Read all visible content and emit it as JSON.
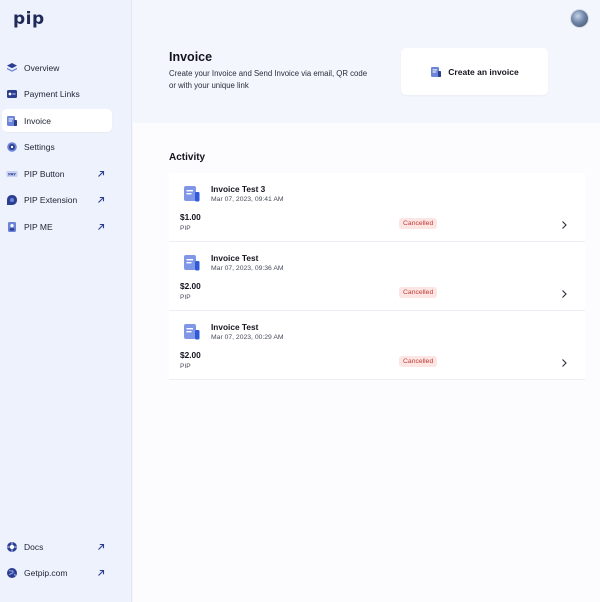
{
  "app": {
    "logo_text": "pip"
  },
  "sidebar": {
    "items": [
      {
        "label": "Overview",
        "icon": "layers-icon",
        "active": false,
        "external": false
      },
      {
        "label": "Payment Links",
        "icon": "link-icon",
        "active": false,
        "external": false
      },
      {
        "label": "Invoice",
        "icon": "invoice-icon",
        "active": true,
        "external": false
      },
      {
        "label": "Settings",
        "icon": "gear-icon",
        "active": false,
        "external": false
      },
      {
        "label": "PIP Button",
        "icon": "pay-button-icon",
        "active": false,
        "external": true
      },
      {
        "label": "PIP Extension",
        "icon": "extension-icon",
        "active": false,
        "external": true
      },
      {
        "label": "PIP ME",
        "icon": "profile-card-icon",
        "active": false,
        "external": true
      }
    ],
    "bottom_items": [
      {
        "label": "Docs",
        "icon": "lifebuoy-icon",
        "external": true
      },
      {
        "label": "Getpip.com",
        "icon": "globe-icon",
        "external": true
      }
    ],
    "pay_badge_text": "PAY"
  },
  "header": {
    "title": "Invoice",
    "description": "Create your Invoice and Send Invoice via email, QR code or with your unique link",
    "create_button_label": "Create an invoice"
  },
  "activity": {
    "title": "Activity",
    "items": [
      {
        "name": "Invoice Test 3",
        "date": "Mar 07, 2023, 09:41 AM",
        "amount": "$1.00",
        "chain": "PIP",
        "status": "Cancelled"
      },
      {
        "name": "Invoice Test",
        "date": "Mar 07, 2023, 09:36 AM",
        "amount": "$2.00",
        "chain": "PIP",
        "status": "Cancelled"
      },
      {
        "name": "Invoice Test",
        "date": "Mar 07, 2023, 00:29 AM",
        "amount": "$2.00",
        "chain": "PIP",
        "status": "Cancelled"
      }
    ]
  },
  "colors": {
    "brand": "#1f2a5a",
    "accent": "#3b5bdb",
    "status_cancelled_text": "#c23a35",
    "status_cancelled_bg": "#fbe6e4"
  }
}
